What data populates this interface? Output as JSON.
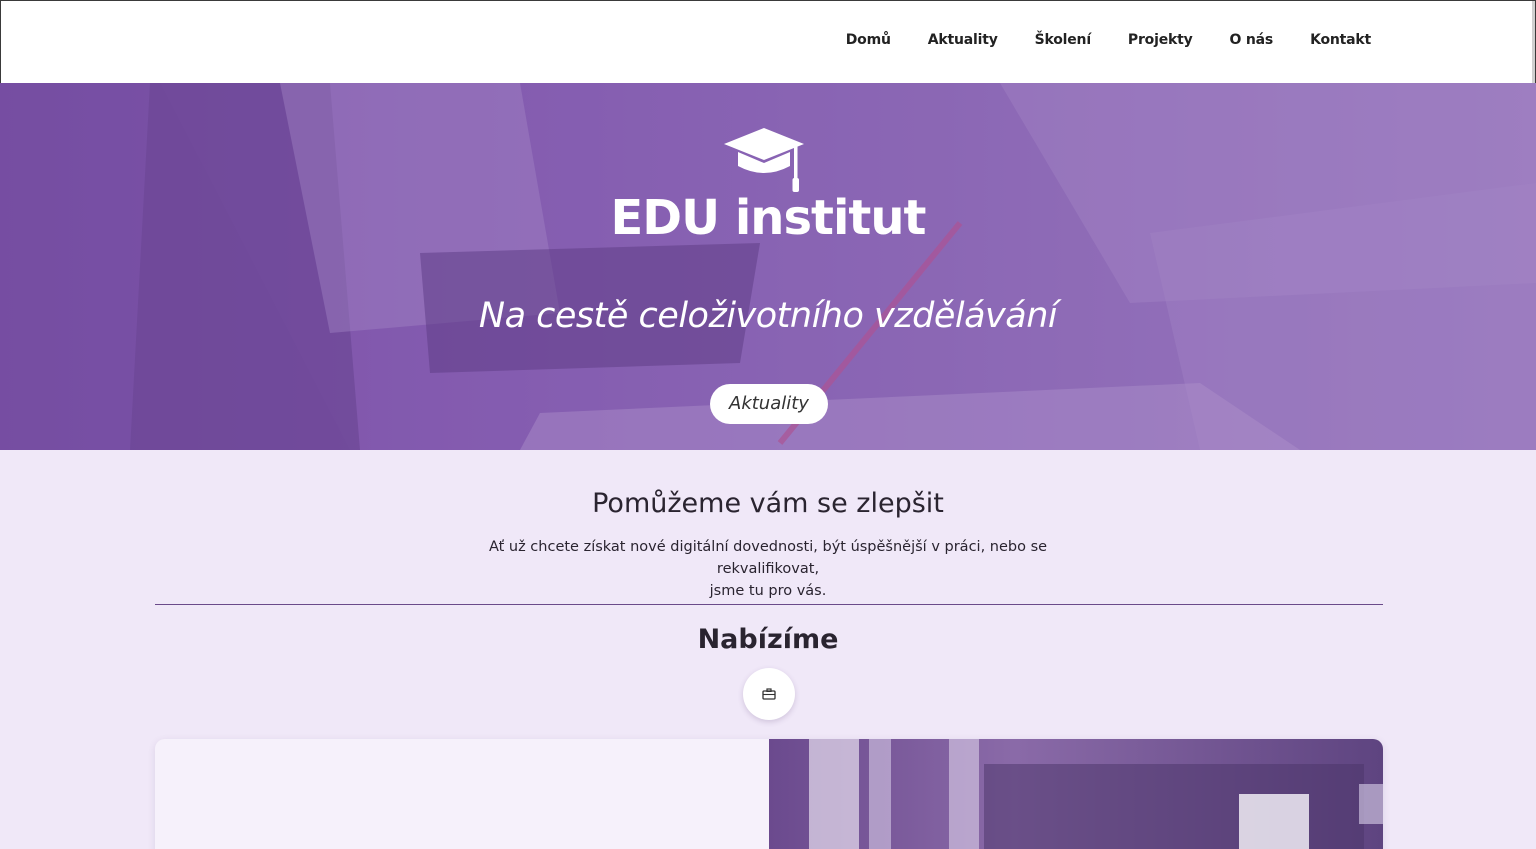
{
  "nav": {
    "items": [
      {
        "label": "Domů"
      },
      {
        "label": "Aktuality"
      },
      {
        "label": "Školení"
      },
      {
        "label": "Projekty"
      },
      {
        "label": "O nás"
      },
      {
        "label": "Kontakt"
      }
    ]
  },
  "hero": {
    "logo_text": "EDU institut",
    "logo_icon": "graduation-cap-icon",
    "tagline": "Na cestě celoživotního vzdělávání",
    "button_label": "Aktuality"
  },
  "intro": {
    "heading": "Pomůžeme vám se zlepšit",
    "text_line1": "Ať už chcete získat nové digitální dovednosti, být úspěšnější v práci, nebo se rekvalifikovat,",
    "text_line2": "jsme tu pro vás."
  },
  "offer": {
    "heading": "Nabízíme",
    "icon": "briefcase-icon"
  },
  "colors": {
    "accent": "#7b55a6",
    "background": "#f0e8f8",
    "divider": "#6a4a8a"
  }
}
